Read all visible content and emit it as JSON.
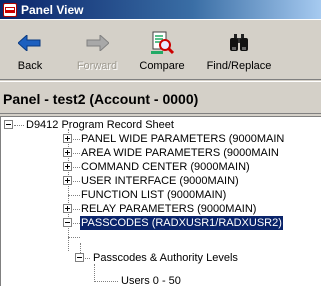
{
  "window": {
    "title": "Panel View"
  },
  "toolbar": {
    "back_label": "Back",
    "forward_label": "Forward",
    "compare_label": "Compare",
    "find_replace_label": "Find/Replace"
  },
  "header": {
    "title": "Panel - test2 (Account - 0000)"
  },
  "tree": {
    "root": "D9412 Program Record Sheet",
    "items": [
      "PANEL WIDE PARAMETERS (9000MAIN",
      "AREA WIDE PARAMETERS (9000MAIN",
      "COMMAND CENTER (9000MAIN)",
      "USER INTERFACE (9000MAIN)",
      "FUNCTION LIST (9000MAIN)",
      "RELAY PARAMETERS (9000MAIN)",
      "PASSCODES (RADXUSR1/RADXUSR2)"
    ],
    "child": "Passcodes & Authority Levels",
    "grandchild": "Users 0 - 50"
  },
  "colors": {
    "titlebar": "#0a246a",
    "selection": "#0a246a",
    "back_arrow": "#1c5fbf"
  }
}
